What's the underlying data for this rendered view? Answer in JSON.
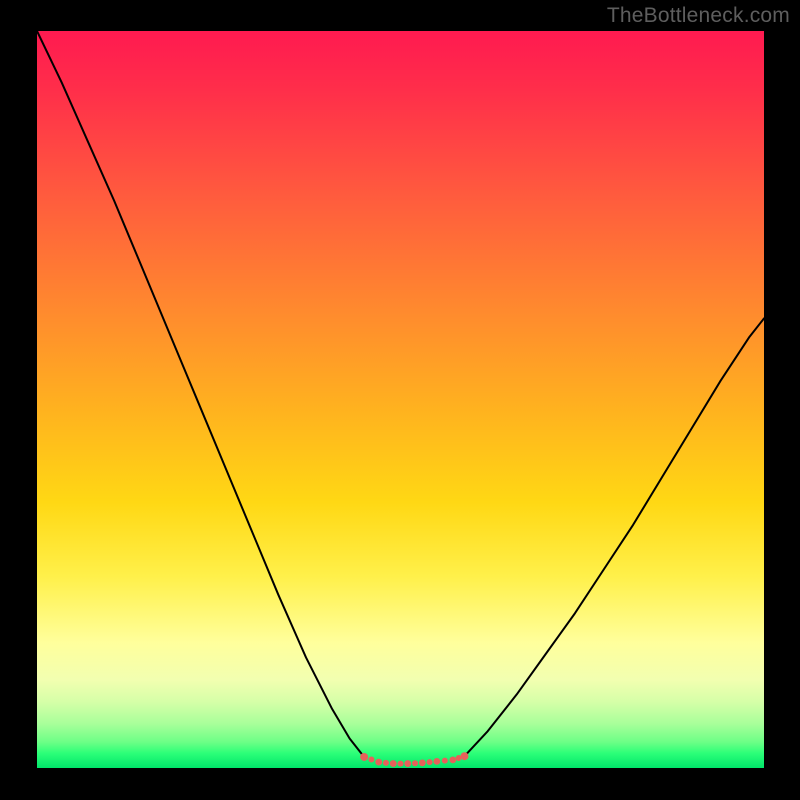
{
  "watermark": "TheBottleneck.com",
  "chart_data": {
    "type": "line",
    "title": "",
    "xlabel": "",
    "ylabel": "",
    "xlim": [
      0,
      100
    ],
    "ylim": [
      0,
      100
    ],
    "background_gradient": {
      "direction": "vertical",
      "stops": [
        {
          "pct": 0,
          "color": "#ff1a50"
        },
        {
          "pct": 22,
          "color": "#ff5a3e"
        },
        {
          "pct": 52,
          "color": "#ffb41e"
        },
        {
          "pct": 74,
          "color": "#fff04a"
        },
        {
          "pct": 91,
          "color": "#d6ffa8"
        },
        {
          "pct": 100,
          "color": "#00e56a"
        }
      ]
    },
    "series": [
      {
        "name": "left-descent",
        "stroke": "#000000",
        "x": [
          0.0,
          3.4,
          7.0,
          10.6,
          14.2,
          18.0,
          21.8,
          25.6,
          29.4,
          33.2,
          37.0,
          40.6,
          43.0,
          45.0
        ],
        "y": [
          100.0,
          93.0,
          85.0,
          77.0,
          68.5,
          59.5,
          50.5,
          41.5,
          32.5,
          23.5,
          15.0,
          8.0,
          4.0,
          1.5
        ]
      },
      {
        "name": "valley-floor",
        "stroke": "#e7605a",
        "style": "thick-dotted",
        "x": [
          45.0,
          47.0,
          49.0,
          51.0,
          53.0,
          55.0,
          57.2,
          58.8
        ],
        "y": [
          1.5,
          0.8,
          0.6,
          0.6,
          0.7,
          0.9,
          1.1,
          1.6
        ]
      },
      {
        "name": "right-ascent",
        "stroke": "#000000",
        "x": [
          58.8,
          62.0,
          66.0,
          70.0,
          74.0,
          78.0,
          82.0,
          86.0,
          90.0,
          94.0,
          98.0,
          100.0
        ],
        "y": [
          1.6,
          5.0,
          10.0,
          15.5,
          21.0,
          27.0,
          33.0,
          39.5,
          46.0,
          52.5,
          58.5,
          61.0
        ]
      }
    ],
    "markers": [
      {
        "x": 45.0,
        "y": 1.5,
        "color": "#e7605a",
        "r": 4
      },
      {
        "x": 58.8,
        "y": 1.6,
        "color": "#e7605a",
        "r": 4
      }
    ]
  }
}
